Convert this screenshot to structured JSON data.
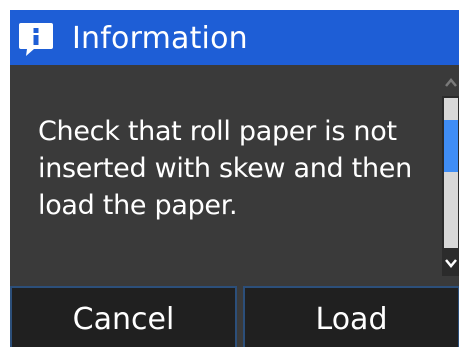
{
  "dialog": {
    "title": "Information",
    "icon": "info-icon",
    "message": "Check that roll paper is not inserted with skew and then load the paper."
  },
  "buttons": {
    "cancel_label": "Cancel",
    "load_label": "Load"
  },
  "colors": {
    "title_bar": "#1e5ed6",
    "background": "#3a3a3a",
    "button": "#202020",
    "scroll_thumb": "#3f8df5",
    "text": "#ffffff"
  }
}
